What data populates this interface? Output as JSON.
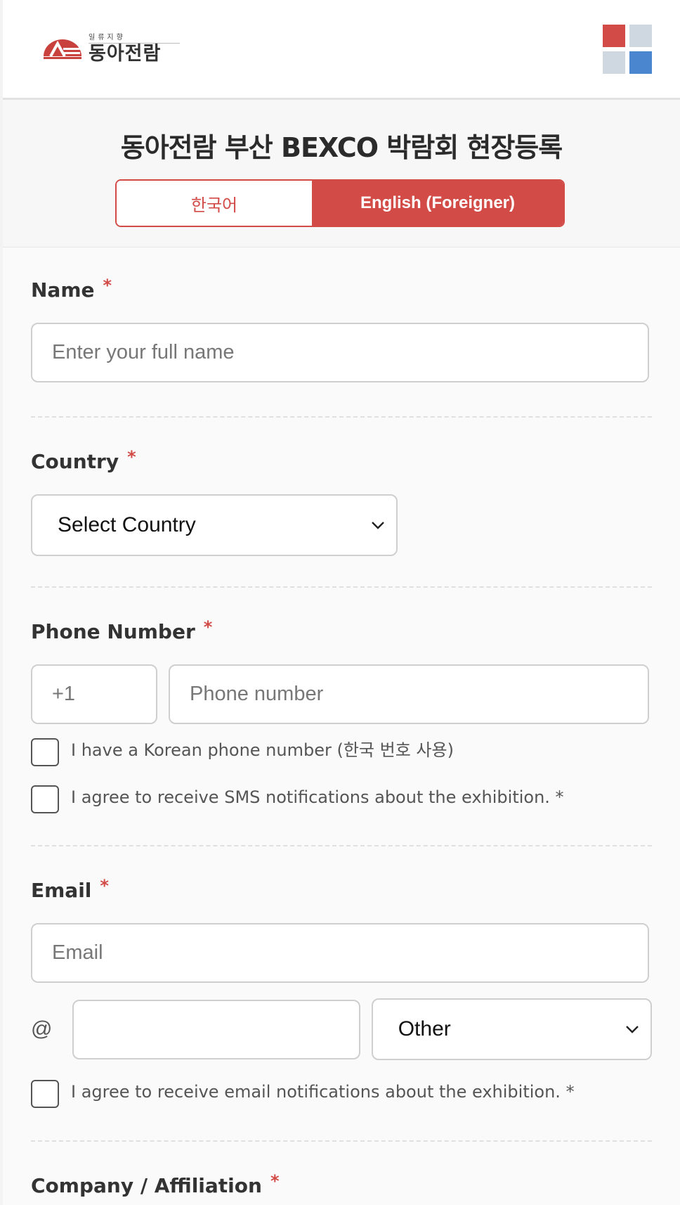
{
  "header": {
    "logo_sub": "일류지향",
    "logo_main": "동아전람",
    "menu_colors": [
      "#d24b47",
      "#cfd7e1",
      "#cfd7e1",
      "#4a86cf"
    ]
  },
  "title": "동아전람 부산 BEXCO 박람회 현장등록",
  "language": {
    "korean": "한국어",
    "english": "English (Foreigner)",
    "selected": "english"
  },
  "accent_color": "#d24b47",
  "form": {
    "name": {
      "label": "Name",
      "required": "*",
      "placeholder": "Enter your full name"
    },
    "country": {
      "label": "Country",
      "required": "*",
      "selected": "Select Country"
    },
    "phone": {
      "label": "Phone Number",
      "required": "*",
      "code_placeholder": "+1",
      "number_placeholder": "Phone number",
      "korean_number_text": "I have a Korean phone number (한국 번호 사용)",
      "sms_agree_text": "I agree to receive SMS notifications about the exhibition. *"
    },
    "email": {
      "label": "Email",
      "required": "*",
      "placeholder": "Email",
      "at": "@",
      "domain_value": "",
      "domain_select": "Other",
      "agree_text": "I agree to receive email notifications about the exhibition. *"
    },
    "company": {
      "label": "Company / Affiliation",
      "required": "*"
    }
  }
}
